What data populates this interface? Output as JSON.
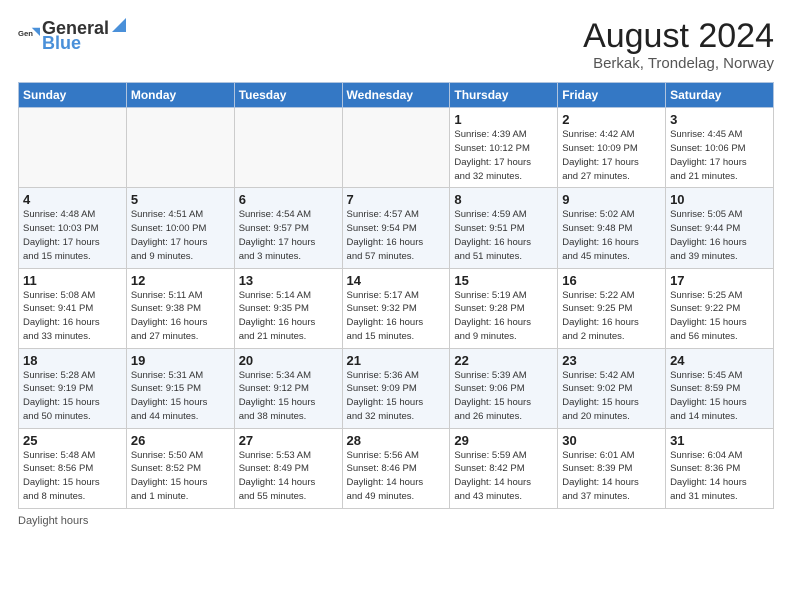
{
  "logo": {
    "text_general": "General",
    "text_blue": "Blue"
  },
  "title": "August 2024",
  "subtitle": "Berkak, Trondelag, Norway",
  "headers": [
    "Sunday",
    "Monday",
    "Tuesday",
    "Wednesday",
    "Thursday",
    "Friday",
    "Saturday"
  ],
  "weeks": [
    [
      {
        "day": "",
        "info": ""
      },
      {
        "day": "",
        "info": ""
      },
      {
        "day": "",
        "info": ""
      },
      {
        "day": "",
        "info": ""
      },
      {
        "day": "1",
        "info": "Sunrise: 4:39 AM\nSunset: 10:12 PM\nDaylight: 17 hours\nand 32 minutes."
      },
      {
        "day": "2",
        "info": "Sunrise: 4:42 AM\nSunset: 10:09 PM\nDaylight: 17 hours\nand 27 minutes."
      },
      {
        "day": "3",
        "info": "Sunrise: 4:45 AM\nSunset: 10:06 PM\nDaylight: 17 hours\nand 21 minutes."
      }
    ],
    [
      {
        "day": "4",
        "info": "Sunrise: 4:48 AM\nSunset: 10:03 PM\nDaylight: 17 hours\nand 15 minutes."
      },
      {
        "day": "5",
        "info": "Sunrise: 4:51 AM\nSunset: 10:00 PM\nDaylight: 17 hours\nand 9 minutes."
      },
      {
        "day": "6",
        "info": "Sunrise: 4:54 AM\nSunset: 9:57 PM\nDaylight: 17 hours\nand 3 minutes."
      },
      {
        "day": "7",
        "info": "Sunrise: 4:57 AM\nSunset: 9:54 PM\nDaylight: 16 hours\nand 57 minutes."
      },
      {
        "day": "8",
        "info": "Sunrise: 4:59 AM\nSunset: 9:51 PM\nDaylight: 16 hours\nand 51 minutes."
      },
      {
        "day": "9",
        "info": "Sunrise: 5:02 AM\nSunset: 9:48 PM\nDaylight: 16 hours\nand 45 minutes."
      },
      {
        "day": "10",
        "info": "Sunrise: 5:05 AM\nSunset: 9:44 PM\nDaylight: 16 hours\nand 39 minutes."
      }
    ],
    [
      {
        "day": "11",
        "info": "Sunrise: 5:08 AM\nSunset: 9:41 PM\nDaylight: 16 hours\nand 33 minutes."
      },
      {
        "day": "12",
        "info": "Sunrise: 5:11 AM\nSunset: 9:38 PM\nDaylight: 16 hours\nand 27 minutes."
      },
      {
        "day": "13",
        "info": "Sunrise: 5:14 AM\nSunset: 9:35 PM\nDaylight: 16 hours\nand 21 minutes."
      },
      {
        "day": "14",
        "info": "Sunrise: 5:17 AM\nSunset: 9:32 PM\nDaylight: 16 hours\nand 15 minutes."
      },
      {
        "day": "15",
        "info": "Sunrise: 5:19 AM\nSunset: 9:28 PM\nDaylight: 16 hours\nand 9 minutes."
      },
      {
        "day": "16",
        "info": "Sunrise: 5:22 AM\nSunset: 9:25 PM\nDaylight: 16 hours\nand 2 minutes."
      },
      {
        "day": "17",
        "info": "Sunrise: 5:25 AM\nSunset: 9:22 PM\nDaylight: 15 hours\nand 56 minutes."
      }
    ],
    [
      {
        "day": "18",
        "info": "Sunrise: 5:28 AM\nSunset: 9:19 PM\nDaylight: 15 hours\nand 50 minutes."
      },
      {
        "day": "19",
        "info": "Sunrise: 5:31 AM\nSunset: 9:15 PM\nDaylight: 15 hours\nand 44 minutes."
      },
      {
        "day": "20",
        "info": "Sunrise: 5:34 AM\nSunset: 9:12 PM\nDaylight: 15 hours\nand 38 minutes."
      },
      {
        "day": "21",
        "info": "Sunrise: 5:36 AM\nSunset: 9:09 PM\nDaylight: 15 hours\nand 32 minutes."
      },
      {
        "day": "22",
        "info": "Sunrise: 5:39 AM\nSunset: 9:06 PM\nDaylight: 15 hours\nand 26 minutes."
      },
      {
        "day": "23",
        "info": "Sunrise: 5:42 AM\nSunset: 9:02 PM\nDaylight: 15 hours\nand 20 minutes."
      },
      {
        "day": "24",
        "info": "Sunrise: 5:45 AM\nSunset: 8:59 PM\nDaylight: 15 hours\nand 14 minutes."
      }
    ],
    [
      {
        "day": "25",
        "info": "Sunrise: 5:48 AM\nSunset: 8:56 PM\nDaylight: 15 hours\nand 8 minutes."
      },
      {
        "day": "26",
        "info": "Sunrise: 5:50 AM\nSunset: 8:52 PM\nDaylight: 15 hours\nand 1 minute."
      },
      {
        "day": "27",
        "info": "Sunrise: 5:53 AM\nSunset: 8:49 PM\nDaylight: 14 hours\nand 55 minutes."
      },
      {
        "day": "28",
        "info": "Sunrise: 5:56 AM\nSunset: 8:46 PM\nDaylight: 14 hours\nand 49 minutes."
      },
      {
        "day": "29",
        "info": "Sunrise: 5:59 AM\nSunset: 8:42 PM\nDaylight: 14 hours\nand 43 minutes."
      },
      {
        "day": "30",
        "info": "Sunrise: 6:01 AM\nSunset: 8:39 PM\nDaylight: 14 hours\nand 37 minutes."
      },
      {
        "day": "31",
        "info": "Sunrise: 6:04 AM\nSunset: 8:36 PM\nDaylight: 14 hours\nand 31 minutes."
      }
    ]
  ],
  "footer": "Daylight hours"
}
